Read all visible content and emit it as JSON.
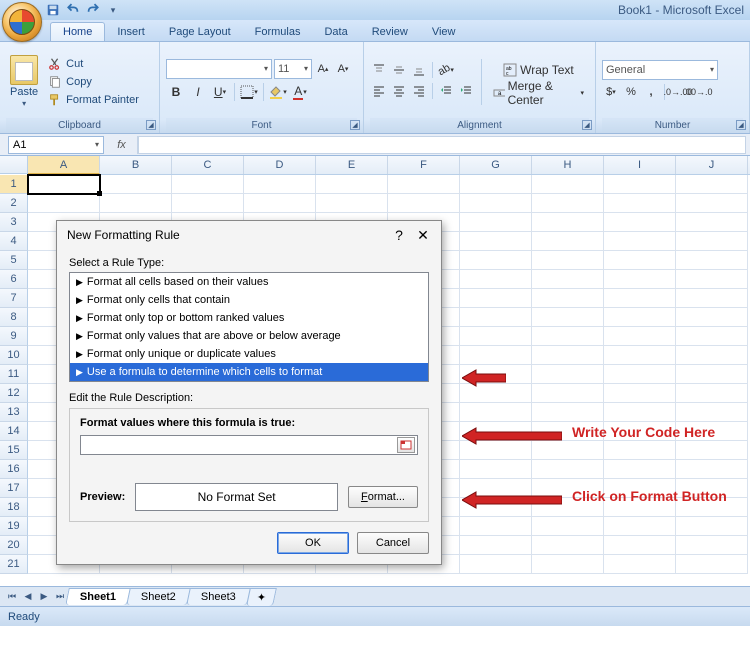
{
  "app": {
    "title": "Book1 - Microsoft Excel"
  },
  "tabs": [
    "Home",
    "Insert",
    "Page Layout",
    "Formulas",
    "Data",
    "Review",
    "View"
  ],
  "ribbon": {
    "clipboard": {
      "paste": "Paste",
      "cut": "Cut",
      "copy": "Copy",
      "painter": "Format Painter",
      "label": "Clipboard"
    },
    "font": {
      "family": "",
      "size": "11",
      "label": "Font"
    },
    "alignment": {
      "wrap": "Wrap Text",
      "merge": "Merge & Center",
      "label": "Alignment"
    },
    "number": {
      "format": "General",
      "label": "Number"
    }
  },
  "namebox": "A1",
  "columns": [
    "A",
    "B",
    "C",
    "D",
    "E",
    "F",
    "G",
    "H",
    "I",
    "J"
  ],
  "rows": 21,
  "sheets": [
    "Sheet1",
    "Sheet2",
    "Sheet3"
  ],
  "status": "Ready",
  "dialog": {
    "title": "New Formatting Rule",
    "select_label": "Select a Rule Type:",
    "rules": [
      "Format all cells based on their values",
      "Format only cells that contain",
      "Format only top or bottom ranked values",
      "Format only values that are above or below average",
      "Format only unique or duplicate values",
      "Use a formula to determine which cells to format"
    ],
    "selected_rule": 5,
    "edit_label": "Edit the Rule Description:",
    "formula_label": "Format values where this formula is true:",
    "preview_label": "Preview:",
    "preview_text": "No Format Set",
    "format_btn": "Format...",
    "ok": "OK",
    "cancel": "Cancel"
  },
  "annotations": {
    "code": "Write Your Code Here",
    "format": "Click on Format Button"
  }
}
